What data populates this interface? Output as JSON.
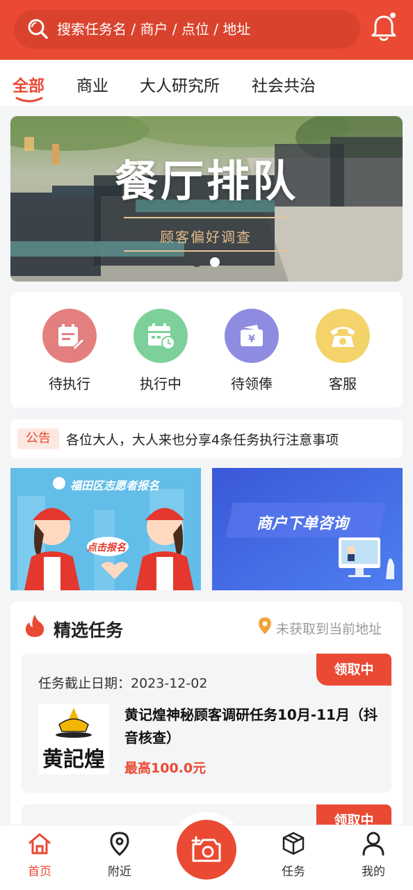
{
  "search": {
    "placeholder": "搜索任务名 / 商户 / 点位 / 地址"
  },
  "tabs": [
    {
      "label": "全部"
    },
    {
      "label": "商业"
    },
    {
      "label": "大人研究所"
    },
    {
      "label": "社会共治"
    }
  ],
  "banner": {
    "title": "餐厅排队",
    "subtitle": "顾客偏好调查",
    "slide_count": 2,
    "active_slide": 2
  },
  "quick_actions": [
    {
      "label": "待执行",
      "icon": "pending-task-icon",
      "color": "#e47f7f"
    },
    {
      "label": "执行中",
      "icon": "calendar-clock-icon",
      "color": "#7dd09a"
    },
    {
      "label": "待领俸",
      "icon": "wallet-yen-icon",
      "color": "#8e8ce0"
    },
    {
      "label": "客服",
      "icon": "phone-icon",
      "color": "#f3d36a"
    }
  ],
  "notice": {
    "badge": "公告",
    "text": "各位大人，大人来也分享4条任务执行注意事项"
  },
  "promos": [
    {
      "title": "福田区志愿者报名",
      "badge": "点击报名"
    },
    {
      "title": "商户下单咨询"
    }
  ],
  "featured": {
    "title": "精选任务",
    "location": "未获取到当前地址",
    "tasks": [
      {
        "badge": "领取中",
        "deadline": "任务截止日期：2023-12-02",
        "logo_text": "黄記煌",
        "name": "黄记煌神秘顾客调研任务10月-11月（抖音核查）",
        "price": "最高100.0元"
      },
      {
        "badge": "领取中"
      }
    ]
  },
  "bottom_nav": [
    {
      "label": "首页",
      "icon": "home-icon",
      "active": true
    },
    {
      "label": "附近",
      "icon": "location-pin-icon"
    },
    {
      "label": "",
      "icon": "camera-add-icon"
    },
    {
      "label": "任务",
      "icon": "box-icon"
    },
    {
      "label": "我的",
      "icon": "user-icon"
    }
  ],
  "colors": {
    "accent": "#ea4a33",
    "background": "#f4f5f7"
  }
}
